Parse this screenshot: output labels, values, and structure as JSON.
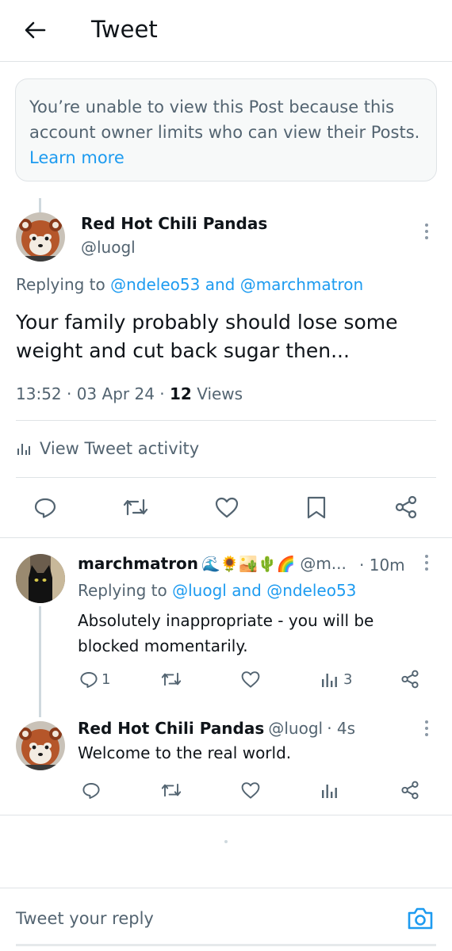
{
  "header": {
    "title": "Tweet"
  },
  "notice": {
    "text": "You’re unable to view this Post because this account owner limits who can view their Posts. ",
    "link": "Learn more"
  },
  "main_tweet": {
    "name": "Red Hot Chili Pandas",
    "handle": "@luogl",
    "replying_prefix": "Replying to ",
    "replying_users": "@ndeleo53 and @marchmatron",
    "text": "Your family probably should lose some weight and cut back sugar then...",
    "time": "13:52 · 03 Apr 24 · ",
    "views_count": "12",
    "views_label": " Views",
    "activity_label": "View Tweet activity"
  },
  "replies": [
    {
      "name": "marchmatron",
      "emojis": "🌊🌻🏜️🌵🌈",
      "handle": "@m...",
      "time": "· 10m",
      "replying_prefix": "Replying to ",
      "replying_users": "@luogl and @ndeleo53",
      "text": "Absolutely inappropriate - you will be blocked momentarily.",
      "reply_count": "1",
      "view_count": "3"
    },
    {
      "name": "Red Hot Chili Pandas",
      "handle": "@luogl",
      "time": "· 4s",
      "text": "Welcome to the real world."
    }
  ],
  "reply_bar": {
    "placeholder": "Tweet your reply"
  },
  "colors": {
    "accent": "#1d9bf0",
    "text": "#0f1419",
    "muted": "#536471",
    "border": "#dfe3e6"
  },
  "icons": [
    "back-arrow-icon",
    "more-icon",
    "reply-icon",
    "retweet-icon",
    "like-icon",
    "bookmark-icon",
    "share-icon",
    "views-icon",
    "camera-icon"
  ]
}
